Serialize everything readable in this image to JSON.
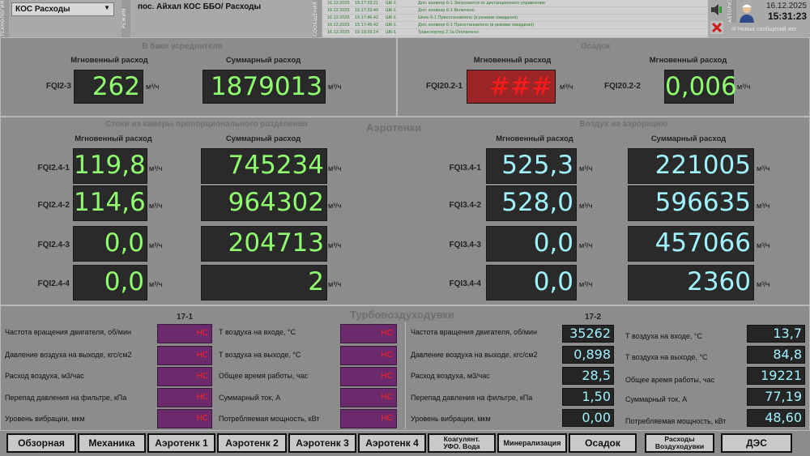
{
  "header": {
    "tab_left": "ТЕХНОЛОГИЯ",
    "tab_mid": "РЕЖИМ",
    "tab_events": "СООБЩЕНИЯ",
    "tab_user": "АВТОРИЗАЦИЯ",
    "object_select": "КОС Расходы",
    "path": "пос. Айхал КОС ББО/ Расходы",
    "events": [
      {
        "date": "16.12.2025",
        "time": "15:17:33.21",
        "src": "ШК-1",
        "text": "Доп. конвеер 6-1 Запускается от дистанционного управления"
      },
      {
        "date": "16.12.2025",
        "time": "15:17:33.49",
        "src": "ШК-1",
        "text": "Доп. конвеер 6-1 Включено"
      },
      {
        "date": "16.12.2025",
        "time": "15:17:46.42",
        "src": "ШК-1",
        "text": "Шнек 6-1 Приостановлено (в режиме ожидания)"
      },
      {
        "date": "16.12.2025",
        "time": "15:17:46.42",
        "src": "ШК-1",
        "text": "Доп. конвеер 6-1 Приостановлено (в режиме ожидания)"
      },
      {
        "date": "16.12.2025",
        "time": "15:18:39.14",
        "src": "ШК-1",
        "text": "Транспортер 2.1а Отключено"
      }
    ],
    "date": "16.12.2025",
    "time": "15:31:23",
    "no_messages": "Новых сообщений нет"
  },
  "tanks": {
    "title": "В баки усреднителя",
    "instant_label": "Мгновенный расход",
    "total_label": "Суммарный расход",
    "tag": "FQI2-3",
    "instant": "262",
    "total": "1879013",
    "unit": "м³/ч"
  },
  "sediment": {
    "title": "Осадок",
    "instant_label": "Мгновенный расход",
    "total_label": "Мгновенный расход",
    "tag1": "FQI20.2-1",
    "value1": "###",
    "tag2": "FQI20.2-2",
    "value2": "0,006",
    "unit": "м³/ч"
  },
  "aero": {
    "title": "Аэротенки",
    "left_title": "Стоки из камеры пропорционального разделения",
    "right_title": "Воздух на аэрорацию",
    "instant_label": "Мгновенный расход",
    "total_label": "Суммарный расход",
    "unit": "м³/ч",
    "left": [
      {
        "tag": "FQI2.4-1",
        "instant": "119,8",
        "total": "745234"
      },
      {
        "tag": "FQI2.4-2",
        "instant": "114,6",
        "total": "964302"
      },
      {
        "tag": "FQI2.4-3",
        "instant": "0,0",
        "total": "204713"
      },
      {
        "tag": "FQI2.4-4",
        "instant": "0,0",
        "total": "2"
      }
    ],
    "right": [
      {
        "tag": "FQI3.4-1",
        "instant": "525,3",
        "total": "221005"
      },
      {
        "tag": "FQI3.4-2",
        "instant": "528,0",
        "total": "596635"
      },
      {
        "tag": "FQI3.4-3",
        "instant": "0,0",
        "total": "457066"
      },
      {
        "tag": "FQI3.4-4",
        "instant": "0,0",
        "total": "2360"
      }
    ]
  },
  "turbo": {
    "title": "Турбовоздуходувки",
    "unit1_title": "17-1",
    "unit2_title": "17-2",
    "left_labels": [
      "Частота вращения двигателя, об/мин",
      "Давление воздуха на выходе, кгс/см2",
      "Расход воздуха, м3/час",
      "Перепад давления на фильтре, кПа",
      "Уровень вибрации, мкм"
    ],
    "right_labels": [
      "Т воздуха на входе, °С",
      "Т воздуха на выходе, °С",
      "Общее время работы, час",
      "Суммарный ток, А",
      "Потребляемая мощность, кВт"
    ],
    "unit1_left": [
      "НС",
      "НС",
      "НС",
      "НС",
      "НС"
    ],
    "unit1_right": [
      "НС",
      "НС",
      "НС",
      "НС",
      "НС"
    ],
    "unit2_left": [
      "35262",
      "0,898",
      "28,5",
      "1,50",
      "0,00"
    ],
    "unit2_right": [
      "13,7",
      "84,8",
      "19221",
      "77,19",
      "48,60"
    ]
  },
  "nav": {
    "b1": "Обзорная",
    "b2": "Механика",
    "b3": "Аэротенк 1",
    "b4": "Аэротенк 2",
    "b5": "Аэротенк 3",
    "b6": "Аэротенк 4",
    "b7a": "Коагулянт.",
    "b7b": "УФО. Вода",
    "b8": "Минерализация",
    "b9": "Осадок",
    "b10a": "Расходы",
    "b10b": "Воздуходувки",
    "b11": "ДЭС"
  }
}
